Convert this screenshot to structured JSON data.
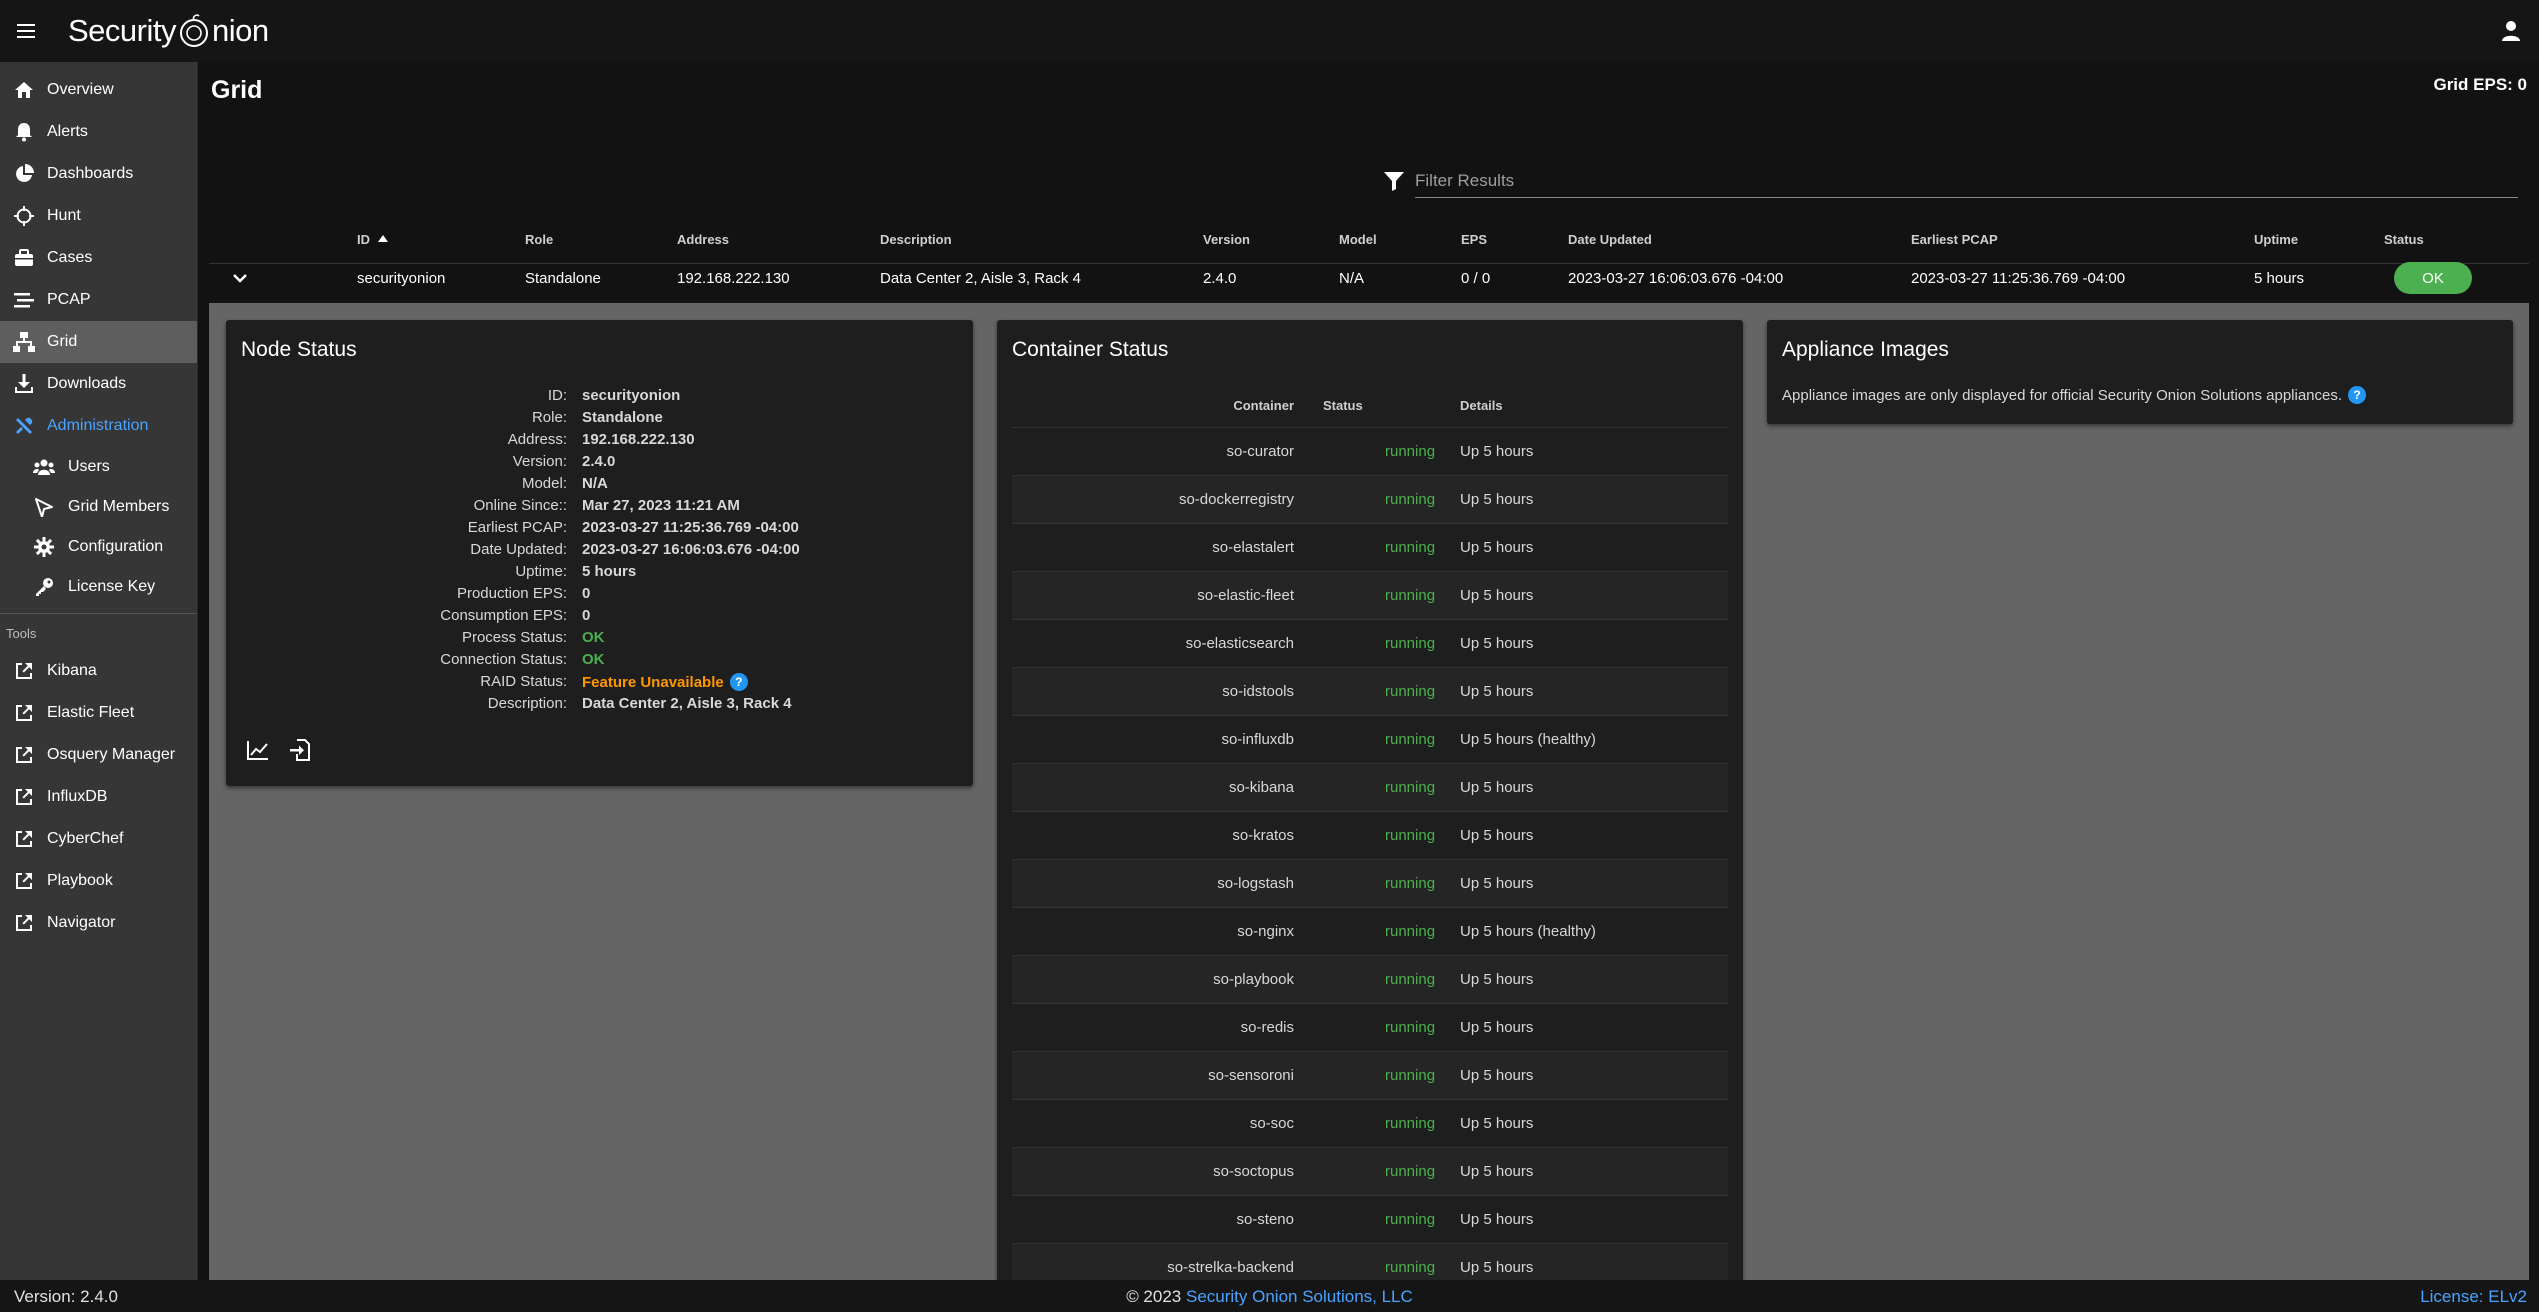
{
  "app": {
    "logo_text_a": "Security",
    "logo_text_b": "nion"
  },
  "colors": {
    "accent": "#4aa3ff",
    "ok": "#4caf50",
    "warning": "#ff9800",
    "help": "#2196f3"
  },
  "sidebar": {
    "items": [
      {
        "label": "Overview",
        "icon": "home-icon"
      },
      {
        "label": "Alerts",
        "icon": "bell-icon"
      },
      {
        "label": "Dashboards",
        "icon": "pie-chart-icon"
      },
      {
        "label": "Hunt",
        "icon": "crosshairs-icon"
      },
      {
        "label": "Cases",
        "icon": "briefcase-icon"
      },
      {
        "label": "PCAP",
        "icon": "stream-icon"
      },
      {
        "label": "Grid",
        "icon": "network-icon"
      },
      {
        "label": "Downloads",
        "icon": "download-icon"
      }
    ],
    "admin_label": "Administration",
    "admin_items": [
      {
        "label": "Users",
        "icon": "users-icon"
      },
      {
        "label": "Grid Members",
        "icon": "satellite-dish-icon"
      },
      {
        "label": "Configuration",
        "icon": "gear-icon"
      },
      {
        "label": "License Key",
        "icon": "key-icon"
      }
    ],
    "tools_label": "Tools",
    "tools": [
      {
        "label": "Kibana"
      },
      {
        "label": "Elastic Fleet"
      },
      {
        "label": "Osquery Manager"
      },
      {
        "label": "InfluxDB"
      },
      {
        "label": "CyberChef"
      },
      {
        "label": "Playbook"
      },
      {
        "label": "Navigator"
      }
    ]
  },
  "header": {
    "title": "Grid",
    "grid_eps": "Grid EPS: 0"
  },
  "filter": {
    "placeholder": "Filter Results"
  },
  "table": {
    "columns": {
      "id": "ID",
      "role": "Role",
      "address": "Address",
      "description": "Description",
      "version": "Version",
      "model": "Model",
      "eps": "EPS",
      "date_updated": "Date Updated",
      "earliest_pcap": "Earliest PCAP",
      "uptime": "Uptime",
      "status": "Status"
    },
    "row": {
      "id": "securityonion",
      "role": "Standalone",
      "address": "192.168.222.130",
      "description": "Data Center 2, Aisle 3, Rack 4",
      "version": "2.4.0",
      "model": "N/A",
      "eps": "0 / 0",
      "date_updated": "2023-03-27 16:06:03.676 -04:00",
      "earliest_pcap": "2023-03-27 11:25:36.769 -04:00",
      "uptime": "5 hours",
      "status": "OK"
    }
  },
  "node_status": {
    "title": "Node Status",
    "fields": [
      {
        "key": "ID:",
        "value": "securityonion"
      },
      {
        "key": "Role:",
        "value": "Standalone"
      },
      {
        "key": "Address:",
        "value": "192.168.222.130"
      },
      {
        "key": "Version:",
        "value": "2.4.0"
      },
      {
        "key": "Model:",
        "value": "N/A"
      },
      {
        "key": "Online Since::",
        "value": "Mar 27, 2023 11:21 AM"
      },
      {
        "key": "Earliest PCAP:",
        "value": "2023-03-27 11:25:36.769 -04:00"
      },
      {
        "key": "Date Updated:",
        "value": "2023-03-27 16:06:03.676 -04:00"
      },
      {
        "key": "Uptime:",
        "value": "5 hours"
      },
      {
        "key": "Production EPS:",
        "value": "0"
      },
      {
        "key": "Consumption EPS:",
        "value": "0"
      },
      {
        "key": "Process Status:",
        "value": "OK"
      },
      {
        "key": "Connection Status:",
        "value": "OK"
      },
      {
        "key": "RAID Status:",
        "value": "Feature Unavailable"
      },
      {
        "key": "Description:",
        "value": "Data Center 2, Aisle 3, Rack 4"
      }
    ],
    "help_glyph": "?"
  },
  "container_status": {
    "title": "Container Status",
    "columns": {
      "container": "Container",
      "status": "Status",
      "details": "Details"
    },
    "rows": [
      {
        "name": "so-curator",
        "status": "running",
        "details": "Up 5 hours"
      },
      {
        "name": "so-dockerregistry",
        "status": "running",
        "details": "Up 5 hours"
      },
      {
        "name": "so-elastalert",
        "status": "running",
        "details": "Up 5 hours"
      },
      {
        "name": "so-elastic-fleet",
        "status": "running",
        "details": "Up 5 hours"
      },
      {
        "name": "so-elasticsearch",
        "status": "running",
        "details": "Up 5 hours"
      },
      {
        "name": "so-idstools",
        "status": "running",
        "details": "Up 5 hours"
      },
      {
        "name": "so-influxdb",
        "status": "running",
        "details": "Up 5 hours (healthy)"
      },
      {
        "name": "so-kibana",
        "status": "running",
        "details": "Up 5 hours"
      },
      {
        "name": "so-kratos",
        "status": "running",
        "details": "Up 5 hours"
      },
      {
        "name": "so-logstash",
        "status": "running",
        "details": "Up 5 hours"
      },
      {
        "name": "so-nginx",
        "status": "running",
        "details": "Up 5 hours (healthy)"
      },
      {
        "name": "so-playbook",
        "status": "running",
        "details": "Up 5 hours"
      },
      {
        "name": "so-redis",
        "status": "running",
        "details": "Up 5 hours"
      },
      {
        "name": "so-sensoroni",
        "status": "running",
        "details": "Up 5 hours"
      },
      {
        "name": "so-soc",
        "status": "running",
        "details": "Up 5 hours"
      },
      {
        "name": "so-soctopus",
        "status": "running",
        "details": "Up 5 hours"
      },
      {
        "name": "so-steno",
        "status": "running",
        "details": "Up 5 hours"
      },
      {
        "name": "so-strelka-backend",
        "status": "running",
        "details": "Up 5 hours"
      }
    ]
  },
  "appliance_images": {
    "title": "Appliance Images",
    "message": "Appliance images are only displayed for official Security Onion Solutions appliances.",
    "help_glyph": "?"
  },
  "footer": {
    "version": "Version: 2.4.0",
    "copyright_prefix": "© 2023",
    "company": "Security Onion Solutions, LLC",
    "license": "License: ELv2"
  }
}
